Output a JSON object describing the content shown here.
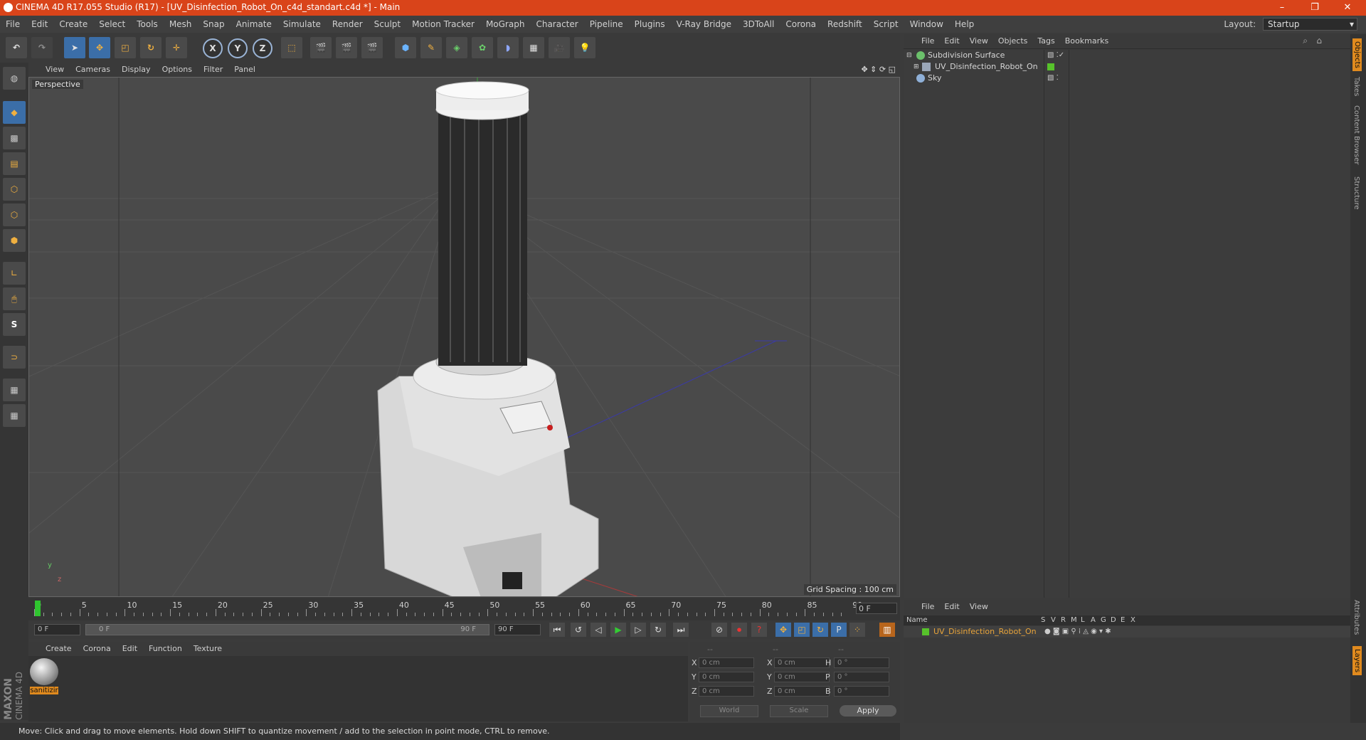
{
  "window": {
    "title": "CINEMA 4D R17.055 Studio (R17) - [UV_Disinfection_Robot_On_c4d_standart.c4d *] - Main",
    "controls": [
      "–",
      "❐",
      "✕"
    ]
  },
  "menubar": {
    "items": [
      "File",
      "Edit",
      "Create",
      "Select",
      "Tools",
      "Mesh",
      "Snap",
      "Animate",
      "Simulate",
      "Render",
      "Sculpt",
      "Motion Tracker",
      "MoGraph",
      "Character",
      "Pipeline",
      "Plugins",
      "V-Ray Bridge",
      "3DToAll",
      "Corona",
      "Redshift",
      "Script",
      "Window",
      "Help"
    ],
    "layout_label": "Layout:",
    "layout_value": "Startup"
  },
  "toolbar": {
    "axis_x": "X",
    "axis_y": "Y",
    "axis_z": "Z"
  },
  "viewport": {
    "menu": [
      "View",
      "Cameras",
      "Display",
      "Options",
      "Filter",
      "Panel"
    ],
    "camera_label": "Perspective",
    "grid_spacing": "Grid Spacing : 100 cm",
    "axis_y": "y",
    "axis_z": "z"
  },
  "timeline": {
    "ticks": [
      "0",
      "5",
      "10",
      "15",
      "20",
      "25",
      "30",
      "35",
      "40",
      "45",
      "50",
      "55",
      "60",
      "65",
      "70",
      "75",
      "80",
      "85",
      "90"
    ],
    "current_frame": "0 F"
  },
  "transport": {
    "start": "0 F",
    "range_start": "0 F",
    "range_end": "90 F",
    "end": "90 F"
  },
  "material_manager": {
    "menu": [
      "Create",
      "Corona",
      "Edit",
      "Function",
      "Texture"
    ],
    "material_name": "sanitizir"
  },
  "coordinates": {
    "header": [
      "--",
      "--",
      "--"
    ],
    "rows": [
      {
        "pos_label": "X",
        "pos": "0 cm",
        "size_label": "X",
        "size": "0 cm",
        "rot_label": "H",
        "rot": "0 °"
      },
      {
        "pos_label": "Y",
        "pos": "0 cm",
        "size_label": "Y",
        "size": "0 cm",
        "rot_label": "P",
        "rot": "0 °"
      },
      {
        "pos_label": "Z",
        "pos": "0 cm",
        "size_label": "Z",
        "size": "0 cm",
        "rot_label": "B",
        "rot": "0 °"
      }
    ],
    "mode1": "World",
    "mode2": "Scale",
    "apply": "Apply"
  },
  "status": {
    "text": "Move: Click and drag to move elements. Hold down SHIFT to quantize movement / add to the selection in point mode, CTRL to remove."
  },
  "object_manager": {
    "menu": [
      "File",
      "Edit",
      "View",
      "Objects",
      "Tags",
      "Bookmarks"
    ],
    "objects": [
      {
        "name": "Subdivision Surface",
        "color": "#6bc06b"
      },
      {
        "name": "UV_Disinfection_Robot_On",
        "color": "#9aa6b8"
      },
      {
        "name": "Sky",
        "color": "#8fb0d8"
      }
    ]
  },
  "right_tabs": [
    "Objects",
    "Takes",
    "Content Browser",
    "Structure",
    "Attributes",
    "Layers"
  ],
  "layer_manager": {
    "menu": [
      "File",
      "Edit",
      "View"
    ],
    "columns": [
      "Name",
      "S",
      "V",
      "R",
      "M",
      "L",
      "A",
      "G",
      "D",
      "E",
      "X"
    ],
    "layer_name": "UV_Disinfection_Robot_On",
    "layer_color": "#57c22b"
  },
  "brand": {
    "line1": "MAXON",
    "line2": "CINEMA 4D"
  }
}
